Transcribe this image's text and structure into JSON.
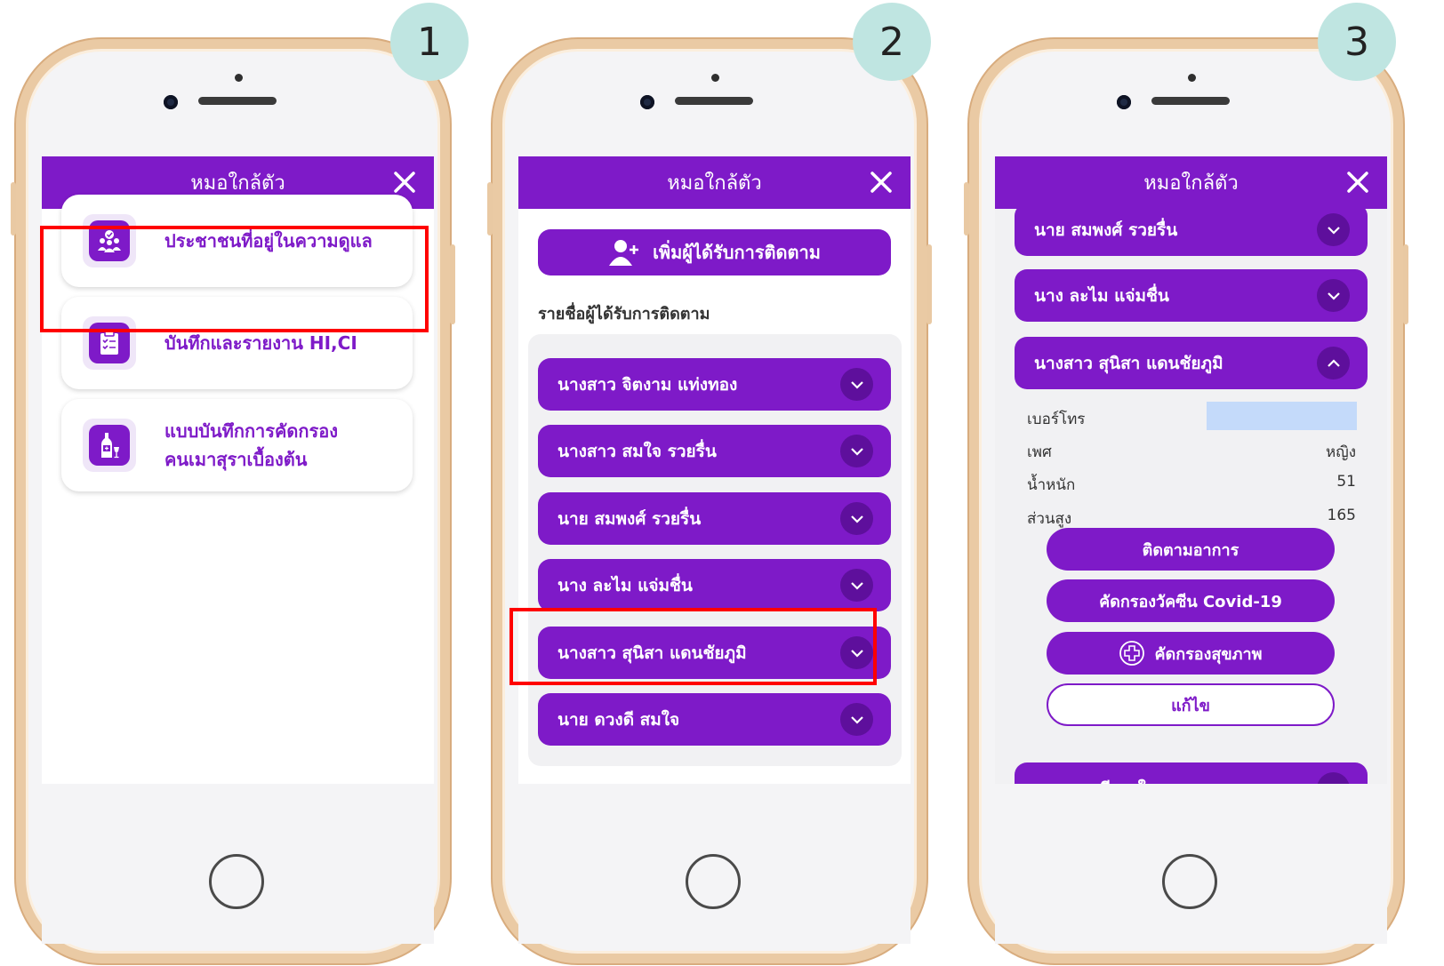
{
  "steps": [
    "1",
    "2",
    "3"
  ],
  "colors": {
    "primary": "#7e1ac8",
    "badge": "#bfe5e1",
    "highlight": "#ff0000",
    "phone_frame": "#eacaa4"
  },
  "app": {
    "title": "หมอใกล้ตัว",
    "close_icon": "close-icon"
  },
  "screen1": {
    "menu": [
      {
        "label": "ประชาชนที่อยู่ในความดูแล",
        "icon": "people-care-icon"
      },
      {
        "label": "บันทึกและรายงาน HI,CI",
        "icon": "clipboard-checklist-icon"
      },
      {
        "label_line1": "แบบบันทึกการคัดกรอง",
        "label_line2": "คนเมาสุราเบื้องต้น",
        "icon": "alcohol-bottle-icon"
      }
    ]
  },
  "screen2": {
    "add_button": "เพิ่มผู้ได้รับการติดตาม",
    "list_title": "รายชื่อผู้ได้รับการติดตาม",
    "people": [
      "นางสาว จิตงาม แท่งทอง",
      "นางสาว สมใจ รวยรื่น",
      "นาย สมพงศ์ รวยรื่น",
      "นาง ละไม แจ่มชื่น",
      "นางสาว สุนิสา แดนชัยภูมิ",
      "นาย ดวงดี สมใจ"
    ]
  },
  "screen3": {
    "people_above": [
      "นาย สมพงศ์ รวยรื่น",
      "นาง ละไม แจ่มชื่น"
    ],
    "expanded_person": "นางสาว สุนิสา แดนชัยภูมิ",
    "details": [
      {
        "label": "เบอร์โทร",
        "value": ""
      },
      {
        "label": "เพศ",
        "value": "หญิง"
      },
      {
        "label": "น้ำหนัก",
        "value": "51"
      },
      {
        "label": "ส่วนสูง",
        "value": "165"
      }
    ],
    "actions": {
      "follow": "ติดตามอาการ",
      "covid": "คัดกรองวัคซีน Covid-19",
      "health": "คัดกรองสุขภาพ",
      "edit": "แก้ไข"
    },
    "people_below": [
      "นาย ดวงดี สมใจ"
    ]
  }
}
